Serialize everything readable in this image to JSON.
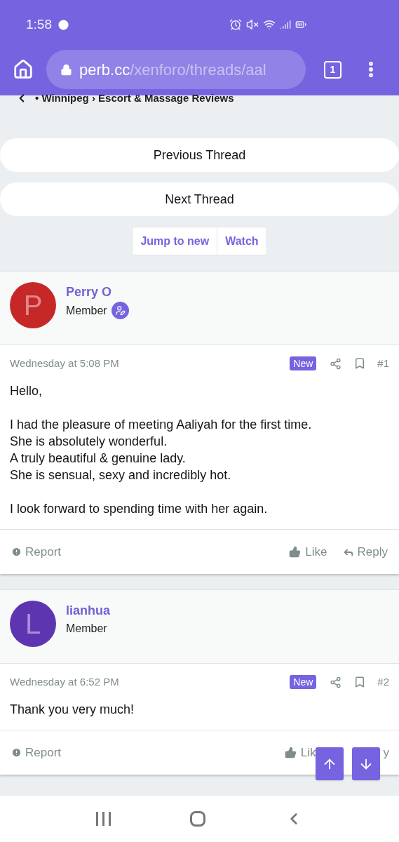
{
  "status_bar": {
    "time": "1:58"
  },
  "browser": {
    "url_host": "perb.cc",
    "url_path": "/xenforo/threads/aal",
    "tab_count": "1"
  },
  "breadcrumb": "• Winnipeg › Escort & Massage Reviews",
  "thread_nav": [
    "Previous Thread",
    "Next Thread"
  ],
  "thread_actions": [
    "Jump to new",
    "Watch"
  ],
  "posts": [
    {
      "author": "Perry O",
      "initial": "P",
      "color": "#c62828",
      "role": "Member",
      "verified": true,
      "date": "Wednesday at 5:08 PM",
      "badge": "New",
      "number": "#1",
      "paragraphs": [
        "Hello,",
        "I had the pleasure of meeting Aaliyah for the first time.\nShe is absolutely wonderful.\nA truly beautiful & genuine lady.\nShe is sensual, sexy and incredibly hot.",
        "I look forward to spending time with her again."
      ],
      "actions": {
        "report": "Report",
        "like": "Like",
        "reply": "Reply"
      },
      "partly_covered": false
    },
    {
      "author": "lianhua",
      "initial": "L",
      "color": "#5e35b1",
      "role": "Member",
      "verified": false,
      "date": "Wednesday at 6:52 PM",
      "badge": "New",
      "number": "#2",
      "paragraphs": [
        "Thank you very much!"
      ],
      "actions": {
        "report": "Report",
        "like": "Lik",
        "reply": "y"
      },
      "partly_covered": true
    }
  ]
}
